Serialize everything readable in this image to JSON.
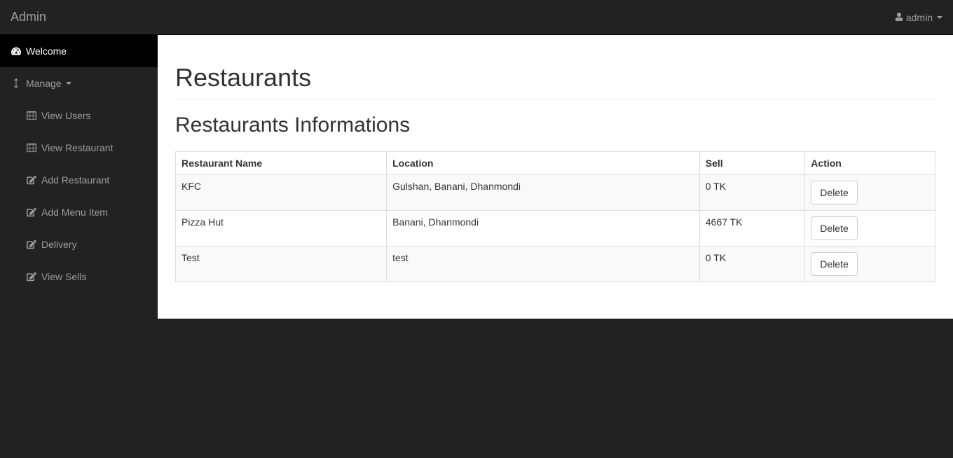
{
  "navbar": {
    "brand": "Admin",
    "user_label": "admin"
  },
  "sidebar": {
    "welcome": "Welcome",
    "manage": "Manage",
    "items": [
      {
        "label": "View Users",
        "icon": "table"
      },
      {
        "label": "View Restaurant",
        "icon": "table"
      },
      {
        "label": "Add Restaurant",
        "icon": "edit"
      },
      {
        "label": "Add Menu Item",
        "icon": "edit"
      },
      {
        "label": "Delivery",
        "icon": "edit"
      },
      {
        "label": "View Sells",
        "icon": "edit"
      }
    ]
  },
  "main": {
    "title": "Restaurants",
    "subtitle": "Restaurants Informations",
    "columns": [
      "Restaurant Name",
      "Location",
      "Sell",
      "Action"
    ],
    "action_label": "Delete",
    "rows": [
      {
        "name": "KFC",
        "location": "Gulshan, Banani, Dhanmondi",
        "sell": "0 TK"
      },
      {
        "name": "Pizza Hut",
        "location": "Banani, Dhanmondi",
        "sell": "4667 TK"
      },
      {
        "name": "Test",
        "location": "test",
        "sell": "0 TK"
      }
    ]
  }
}
